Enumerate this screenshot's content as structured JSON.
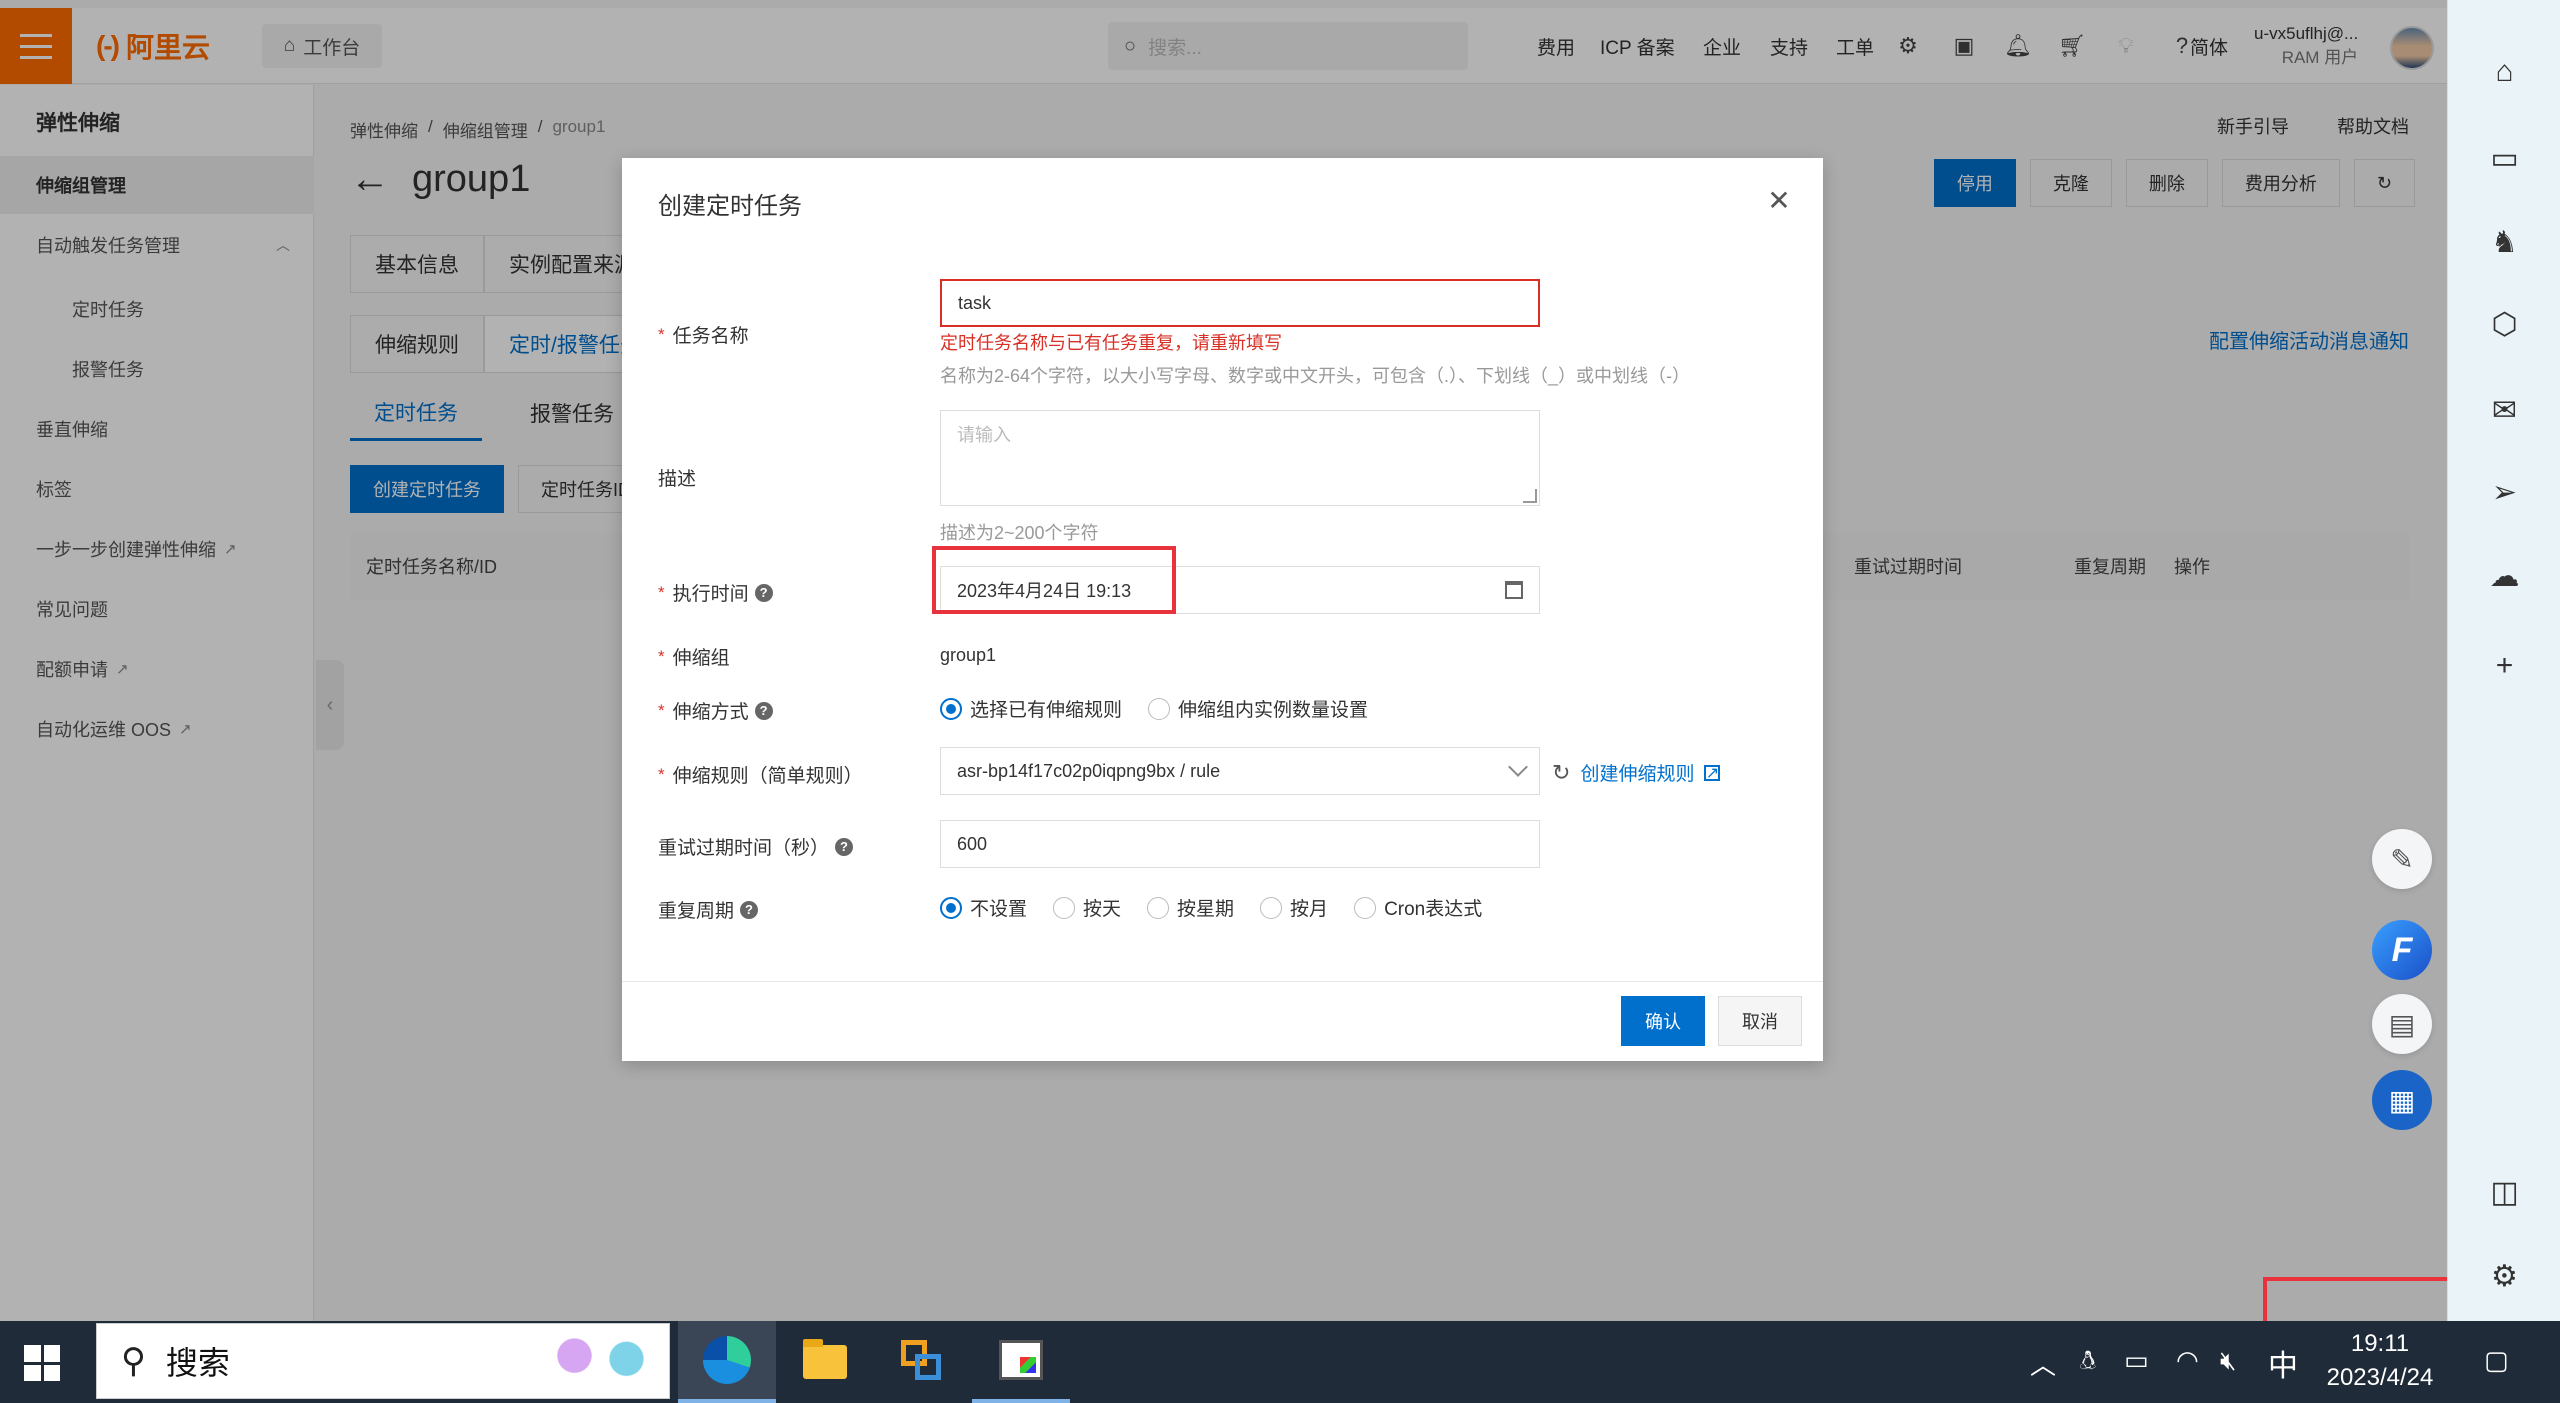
{
  "topbar": {
    "logo_text": "阿里云",
    "logo_mark": "(-)",
    "workbench": "工作台",
    "search_placeholder": "搜索...",
    "nav": [
      "费用",
      "ICP 备案",
      "企业",
      "支持",
      "工单"
    ],
    "lang": "简体",
    "user_name": "u-vx5uflhj@...",
    "user_role": "RAM 用户"
  },
  "leftnav": {
    "title": "弹性伸缩",
    "items": [
      {
        "label": "伸缩组管理"
      },
      {
        "label": "自动触发任务管理"
      },
      {
        "label": "定时任务"
      },
      {
        "label": "报警任务"
      },
      {
        "label": "垂直伸缩"
      },
      {
        "label": "标签"
      },
      {
        "label": "一步一步创建弹性伸缩"
      },
      {
        "label": "常见问题"
      },
      {
        "label": "配额申请"
      },
      {
        "label": "自动化运维 OOS"
      }
    ]
  },
  "page": {
    "breadcrumb": [
      "弹性伸缩",
      "伸缩组管理",
      "group1"
    ],
    "title": "group1",
    "help_links": [
      "新手引导",
      "帮助文档"
    ],
    "actions": [
      "停用",
      "克隆",
      "删除",
      "费用分析"
    ],
    "tabs1": [
      "基本信息",
      "实例配置来源"
    ],
    "tabs2": [
      "伸缩规则",
      "定时/报警任务"
    ],
    "tabs3": [
      "定时任务",
      "报警任务（系"
    ],
    "config_link": "配置伸缩活动消息通知",
    "toolbar": [
      "创建定时任务",
      "定时任务ID"
    ],
    "table_headers": [
      "定时任务名称/ID",
      "重试过期时间",
      "重复周期",
      "操作"
    ]
  },
  "modal": {
    "title": "创建定时任务",
    "task_name_label": "任务名称",
    "task_name_value": "task",
    "task_name_error": "定时任务名称与已有任务重复，请重新填写",
    "task_name_hint": "名称为2-64个字符，以大小写字母、数字或中文开头，可包含（.）、下划线（_）或中划线（-）",
    "desc_label": "描述",
    "desc_placeholder": "请输入",
    "desc_hint": "描述为2~200个字符",
    "exec_time_label": "执行时间",
    "exec_time_value": "2023年4月24日 19:13",
    "group_label": "伸缩组",
    "group_value": "group1",
    "mode_label": "伸缩方式",
    "mode_options": [
      "选择已有伸缩规则",
      "伸缩组内实例数量设置"
    ],
    "mode_selected": 0,
    "rule_label": "伸缩规则（简单规则）",
    "rule_value": "asr-bp14f17c02p0iqpng9bx / rule",
    "create_rule": "创建伸缩规则",
    "retry_label": "重试过期时间（秒）",
    "retry_value": "600",
    "repeat_label": "重复周期",
    "repeat_options": [
      "不设置",
      "按天",
      "按星期",
      "按月",
      "Cron表达式"
    ],
    "repeat_selected": 0,
    "confirm": "确认",
    "cancel": "取消"
  },
  "taskbar": {
    "search_text": "搜索",
    "ime": "中",
    "time": "19:11",
    "date": "2023/4/24"
  },
  "colors": {
    "brand_orange": "#ff6a00",
    "primary_blue": "#0070cc",
    "error_red": "#d93026",
    "highlight_red": "#e8323c"
  }
}
